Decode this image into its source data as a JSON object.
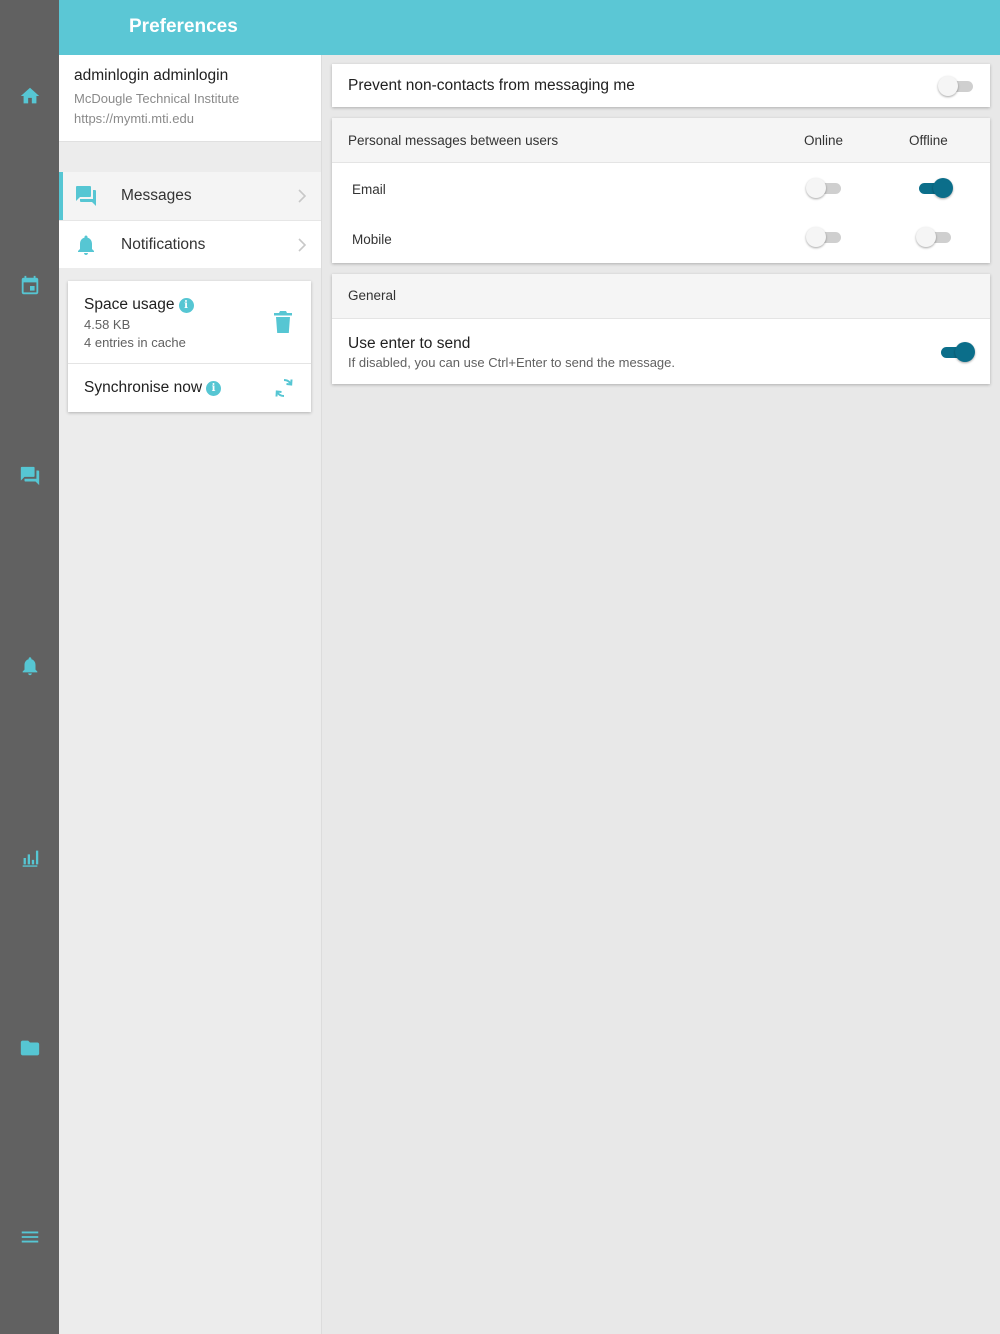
{
  "header": {
    "title": "Preferences"
  },
  "rail": {
    "icons": [
      "home-icon",
      "calendar-icon",
      "messages-icon",
      "notifications-icon",
      "grades-icon",
      "files-icon",
      "more-menu-icon"
    ]
  },
  "account": {
    "name": "adminlogin adminlogin",
    "site": "McDougle Technical Institute",
    "url": "https://mymti.mti.edu"
  },
  "menu": {
    "items": [
      {
        "label": "Messages",
        "icon": "messages-icon",
        "active": true
      },
      {
        "label": "Notifications",
        "icon": "bell-icon",
        "active": false
      }
    ]
  },
  "storage": {
    "space_usage_label": "Space usage",
    "size": "4.58 KB",
    "entries": "4 entries in cache",
    "synchronise_label": "Synchronise now"
  },
  "messaging": {
    "prevent_label": "Prevent non-contacts from messaging me",
    "prevent_on": false
  },
  "personal": {
    "header": "Personal messages between users",
    "col_online": "Online",
    "col_offline": "Offline",
    "rows": [
      {
        "label": "Email",
        "online": false,
        "offline": true
      },
      {
        "label": "Mobile",
        "online": false,
        "offline": false
      }
    ]
  },
  "general": {
    "header": "General",
    "enter_title": "Use enter to send",
    "enter_desc": "If disabled, you can use Ctrl+Enter to send the message.",
    "enter_on": true
  },
  "colors": {
    "accent": "#5bc7d5",
    "toggle_on": "#0b6e8a",
    "rail": "#616161"
  }
}
